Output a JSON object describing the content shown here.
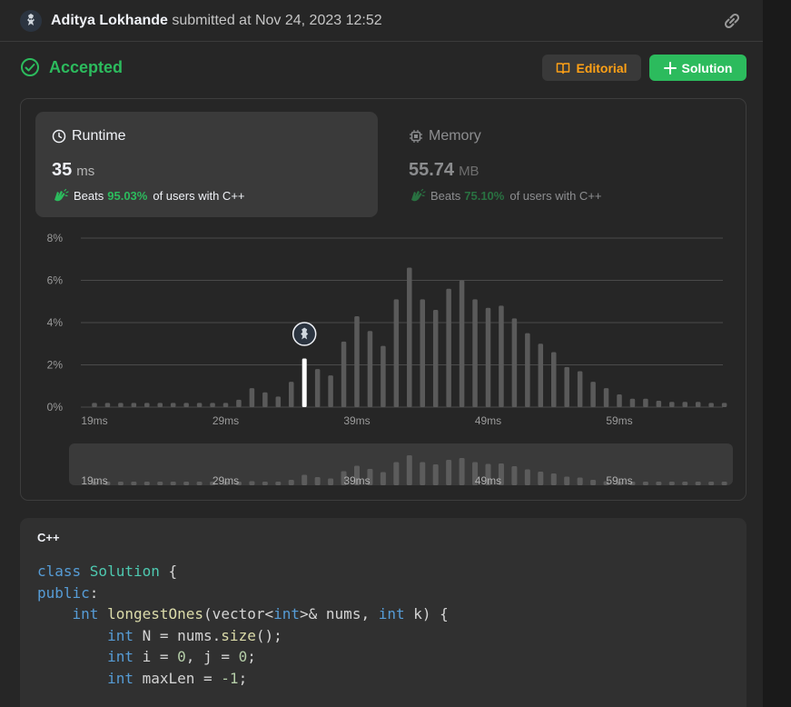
{
  "header": {
    "username": "Aditya Lokhande",
    "submitted_text": "submitted at Nov 24, 2023 12:52"
  },
  "status": {
    "label": "Accepted",
    "color": "#2cbb5d"
  },
  "buttons": {
    "editorial": "Editorial",
    "solution": "Solution"
  },
  "runtime": {
    "title": "Runtime",
    "value": "35",
    "unit": "ms",
    "beats_label": "Beats",
    "beats_pct": "95.03%",
    "beats_suffix": "of users with C++"
  },
  "memory": {
    "title": "Memory",
    "value": "55.74",
    "unit": "MB",
    "beats_label": "Beats",
    "beats_pct": "75.10%",
    "beats_suffix": "of users with C++"
  },
  "chart_data": {
    "type": "bar",
    "ylim": [
      0,
      8
    ],
    "y_ticks": [
      "8%",
      "6%",
      "4%",
      "2%",
      "0%"
    ],
    "x_ticks": [
      "19ms",
      "29ms",
      "39ms",
      "49ms",
      "59ms"
    ],
    "grid": true,
    "highlight_value": 35,
    "x": [
      19,
      20,
      21,
      22,
      23,
      24,
      25,
      26,
      27,
      28,
      29,
      30,
      31,
      32,
      33,
      34,
      35,
      36,
      37,
      38,
      39,
      40,
      41,
      42,
      43,
      44,
      45,
      46,
      47,
      48,
      49,
      50,
      51,
      52,
      53,
      54,
      55,
      56,
      57,
      58,
      59,
      60,
      61,
      62,
      63,
      64,
      65,
      66,
      67
    ],
    "values": [
      0.2,
      0.2,
      0.2,
      0.2,
      0.2,
      0.2,
      0.2,
      0.2,
      0.2,
      0.2,
      0.2,
      0.35,
      0.9,
      0.7,
      0.5,
      1.2,
      2.3,
      1.8,
      1.5,
      3.1,
      4.3,
      3.6,
      2.9,
      5.1,
      6.6,
      5.1,
      4.6,
      5.6,
      6.0,
      5.1,
      4.7,
      4.8,
      4.2,
      3.5,
      3.0,
      2.6,
      1.9,
      1.7,
      1.2,
      0.9,
      0.6,
      0.4,
      0.4,
      0.3,
      0.25,
      0.25,
      0.25,
      0.2,
      0.2
    ],
    "colors": {
      "bar": "#5a5a5a",
      "highlight": "#ffffff",
      "grid": "#4a4a4a"
    }
  },
  "code": {
    "language": "C++",
    "lines": [
      [
        {
          "t": "class ",
          "c": "kw"
        },
        {
          "t": "Solution",
          "c": "cls"
        },
        {
          "t": " {",
          "c": ""
        }
      ],
      [
        {
          "t": "public",
          "c": "kw"
        },
        {
          "t": ":",
          "c": ""
        }
      ],
      [
        {
          "t": "    ",
          "c": ""
        },
        {
          "t": "int",
          "c": "kw"
        },
        {
          "t": " ",
          "c": ""
        },
        {
          "t": "longestOnes",
          "c": "fn"
        },
        {
          "t": "(vector<",
          "c": ""
        },
        {
          "t": "int",
          "c": "kw"
        },
        {
          "t": ">& nums, ",
          "c": ""
        },
        {
          "t": "int",
          "c": "kw"
        },
        {
          "t": " k) {",
          "c": ""
        }
      ],
      [
        {
          "t": "        ",
          "c": ""
        },
        {
          "t": "int",
          "c": "kw"
        },
        {
          "t": " N = nums.",
          "c": ""
        },
        {
          "t": "size",
          "c": "fn"
        },
        {
          "t": "();",
          "c": ""
        }
      ],
      [
        {
          "t": "        ",
          "c": ""
        },
        {
          "t": "int",
          "c": "kw"
        },
        {
          "t": " i = ",
          "c": ""
        },
        {
          "t": "0",
          "c": "num"
        },
        {
          "t": ", j = ",
          "c": ""
        },
        {
          "t": "0",
          "c": "num"
        },
        {
          "t": ";",
          "c": ""
        }
      ],
      [
        {
          "t": "        ",
          "c": ""
        },
        {
          "t": "int",
          "c": "kw"
        },
        {
          "t": " maxLen = ",
          "c": ""
        },
        {
          "t": "-1",
          "c": "num"
        },
        {
          "t": ";",
          "c": ""
        }
      ]
    ]
  }
}
